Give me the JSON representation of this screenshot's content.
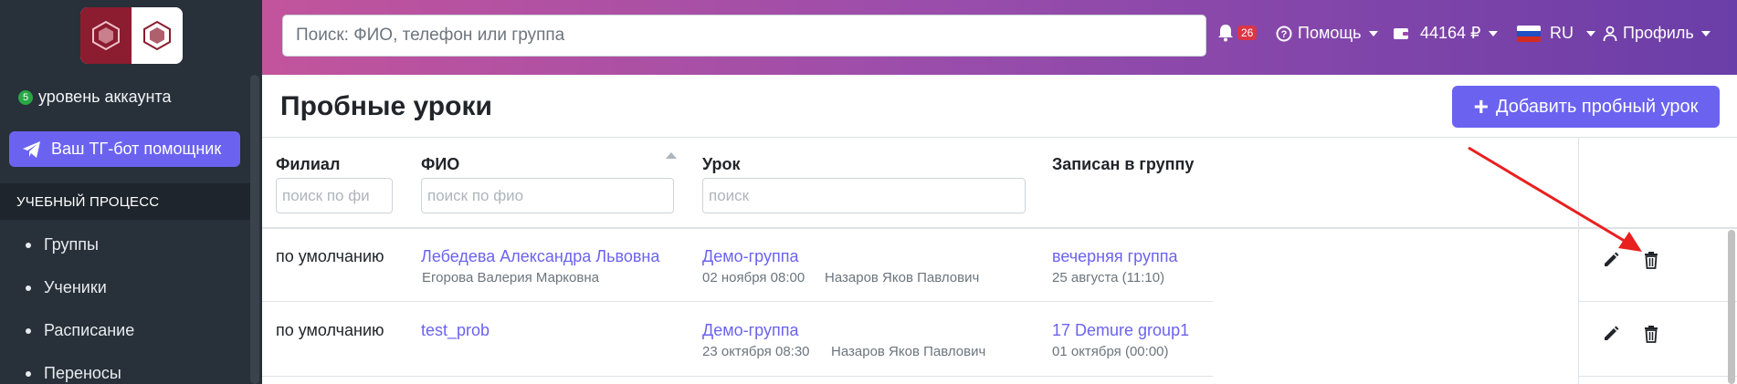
{
  "sidebar": {
    "level_number": "5",
    "level_text": "уровень аккаунта",
    "tg_button": "Ваш ТГ-бот помощник",
    "section_title": "УЧЕБНЫЙ ПРОЦЕСС",
    "items": [
      {
        "label": "Группы"
      },
      {
        "label": "Ученики"
      },
      {
        "label": "Расписание"
      },
      {
        "label": "Переносы"
      }
    ]
  },
  "topbar": {
    "search_placeholder": "Поиск: ФИО, телефон или группа",
    "notifications_count": "26",
    "help_label": "Помощь",
    "balance": "44164 ₽",
    "language": "RU",
    "profile_label": "Профиль"
  },
  "page": {
    "title": "Пробные уроки",
    "add_button": "Добавить пробный урок"
  },
  "table": {
    "columns": {
      "branch": "Филиал",
      "fio": "ФИО",
      "lesson": "Урок",
      "group": "Записан в группу"
    },
    "filters": {
      "branch_placeholder": "поиск по фи",
      "fio_placeholder": "поиск по фио",
      "lesson_placeholder": "поиск"
    },
    "rows": [
      {
        "branch": "по умолчанию",
        "name": "Лебедева Александра Львовна",
        "name_sub": "Егорова Валерия Марковна",
        "lesson": "Демо-группа",
        "lesson_date": "02 ноября 08:00",
        "lesson_teacher": "Назаров Яков Павлович",
        "group": "вечерняя группа",
        "group_date": "25 августа (11:10)"
      },
      {
        "branch": "по умолчанию",
        "name": "test_prob",
        "name_sub": "",
        "lesson": "Демо-группа",
        "lesson_date": "23 октября 08:30",
        "lesson_teacher": "Назаров Яков Павлович",
        "group": "17 Demure group1",
        "group_date": "01 октября (00:00)"
      }
    ]
  },
  "colors": {
    "accent": "#6b63f0",
    "sidebar_bg": "#283039",
    "annotation_arrow": "#e8201f"
  }
}
